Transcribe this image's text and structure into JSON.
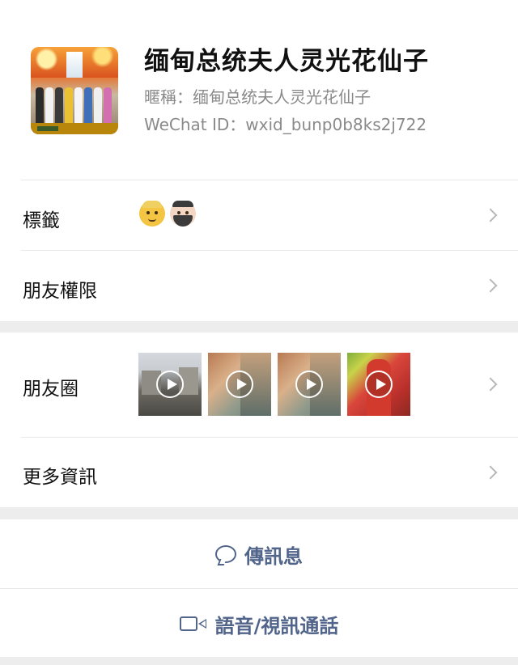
{
  "profile": {
    "display_name": "缅甸总统夫人灵光花仙子",
    "nickname": "暱稱：缅甸总统夫人灵光花仙子",
    "wechat_id": "WeChat ID：wxid_bunp0b8ks2j722"
  },
  "rows": {
    "tags_label": "標籤",
    "tags_emojis": [
      "man-blond-emoji",
      "man-beard-emoji"
    ],
    "permissions_label": "朋友權限",
    "moments_label": "朋友圈",
    "more_info_label": "更多資訊"
  },
  "moments_thumbs": [
    {
      "name": "moment-thumb-building",
      "video": true
    },
    {
      "name": "moment-thumb-person-1",
      "video": true
    },
    {
      "name": "moment-thumb-person-2",
      "video": true
    },
    {
      "name": "moment-thumb-person-red",
      "video": true
    }
  ],
  "actions": {
    "message_label": "傳訊息",
    "call_label": "語音/視訊通話"
  },
  "colors": {
    "action_text": "#51648a",
    "background": "#ededed",
    "row_background": "#ffffff"
  }
}
